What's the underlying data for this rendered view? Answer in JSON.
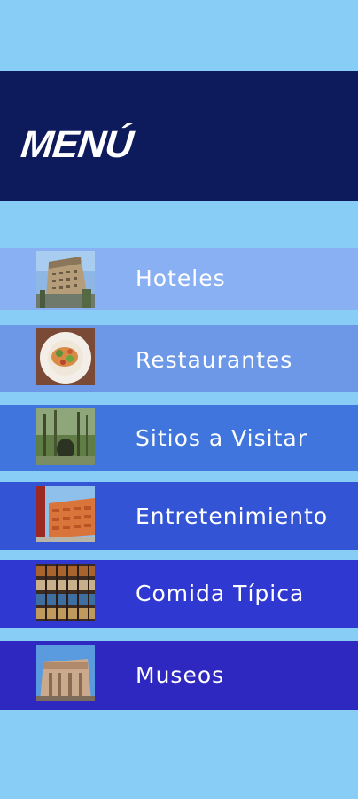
{
  "header": {
    "title": "MENÚ"
  },
  "menu": {
    "items": [
      {
        "label": "Hoteles",
        "icon": "hotel-building-photo",
        "color": "#8ab0f4"
      },
      {
        "label": "Restaurantes",
        "icon": "restaurant-dish-photo",
        "color": "#6d97e7"
      },
      {
        "label": "Sitios a Visitar",
        "icon": "sightseeing-park-photo",
        "color": "#3f75dd"
      },
      {
        "label": "Entretenimiento",
        "icon": "entertainment-mall-photo",
        "color": "#3355d5"
      },
      {
        "label": "Comida Típica",
        "icon": "typical-food-shelf-photo",
        "color": "#2f38d0"
      },
      {
        "label": "Museos",
        "icon": "museum-building-photo",
        "color": "#2e28c1"
      }
    ]
  },
  "colors": {
    "background": "#87cdf5",
    "header": "#0d1a5c",
    "text": "#ffffff"
  }
}
